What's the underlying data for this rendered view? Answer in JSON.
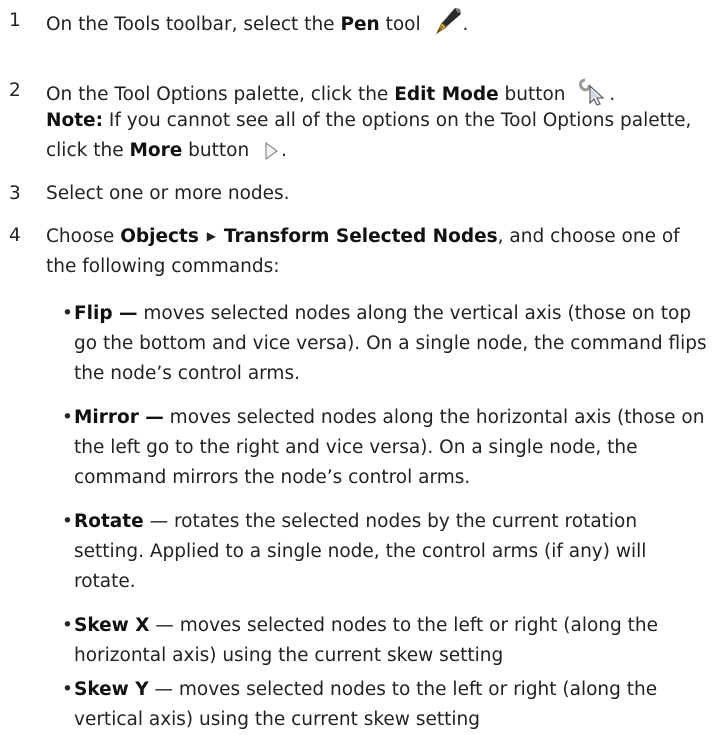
{
  "steps": [
    {
      "number": "1",
      "pre": "On the Tools toolbar, select the ",
      "bold": "Pen",
      "post": " tool",
      "end": ".",
      "icon": "pen-nib-icon"
    },
    {
      "number": "2",
      "pre": "On the Tool Options palette, click the ",
      "bold": "Edit Mode",
      "post": " button",
      "end": ".",
      "icon": "edit-mode-cursor-icon"
    },
    {
      "number": "3",
      "text": "Select one or more nodes."
    },
    {
      "number": "4",
      "pre": "Choose ",
      "menu_objects": "Objects",
      "menu_arrow": "▶",
      "menu_transform": "Transform Selected Nodes",
      "post": ", and choose one of the following commands:"
    }
  ],
  "note": {
    "label": "Note:",
    "text": " If you cannot see all of the options on the Tool Options palette, click the ",
    "bold": "More",
    "post": " button",
    "end": ".",
    "icon": "more-arrow-icon"
  },
  "bullets": [
    {
      "term": "Flip",
      "dash": " —",
      "text": " moves selected nodes along the vertical axis (those on top go the bottom and vice versa). On a single node, the command flips the node’s control arms."
    },
    {
      "term": "Mirror",
      "dash": " —",
      "text": " moves selected nodes along the horizontal axis (those on the left go to the right and vice versa). On a single node, the command mirrors the node’s control arms."
    },
    {
      "term": "Rotate",
      "dash": " —",
      "text": " rotates the selected nodes by the current rotation setting. Applied to a single node, the control arms (if any) will rotate."
    },
    {
      "term": "Skew X",
      "dash": " —",
      "text": " moves selected nodes to the left or right (along the horizontal axis) using the current skew setting"
    },
    {
      "term": "Skew Y",
      "dash": " —",
      "text": " moves selected nodes to the left or right (along the vertical axis) using the current skew setting"
    }
  ],
  "bullet_symbol": "•"
}
